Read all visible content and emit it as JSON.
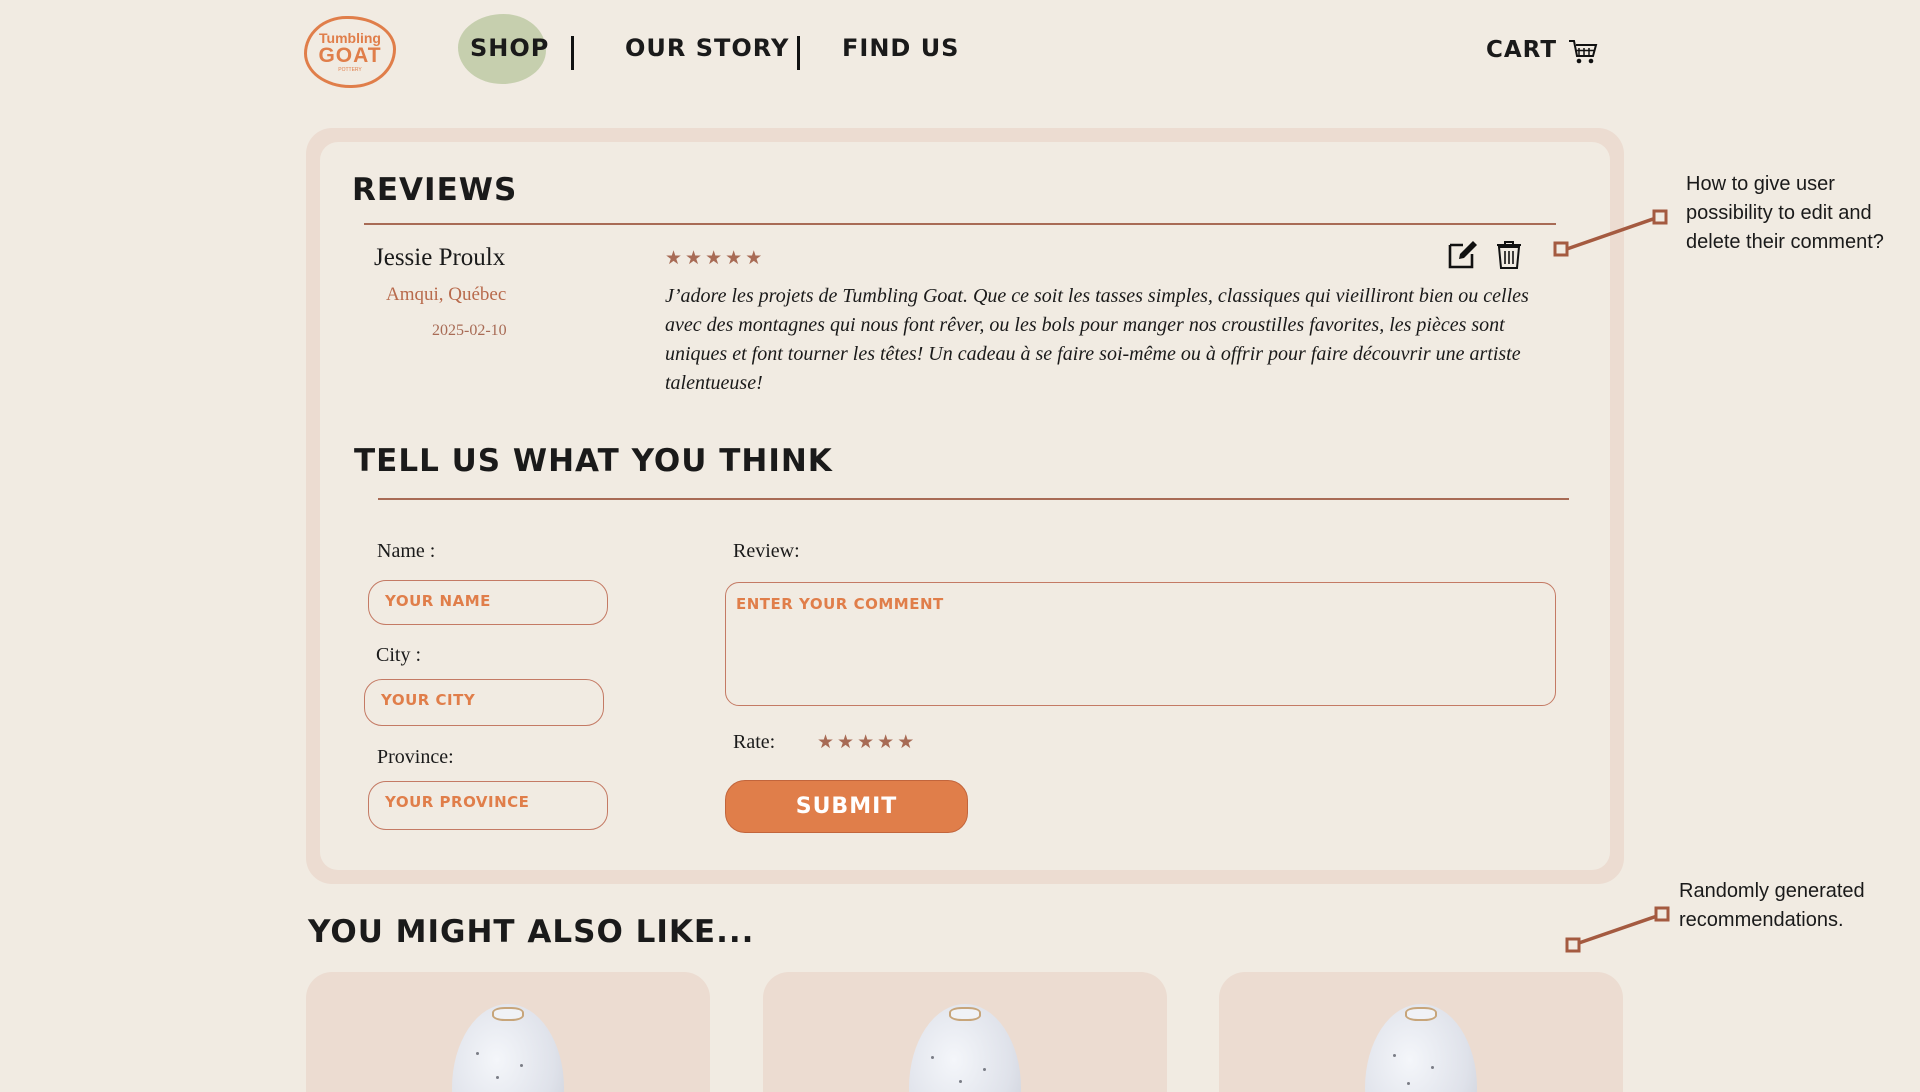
{
  "nav": {
    "logo": {
      "line1": "Tumbling",
      "line2": "GOAT",
      "line3": "POTTERY"
    },
    "items": [
      {
        "label": "Shop"
      },
      {
        "label": "Our Story"
      },
      {
        "label": "Find Us"
      }
    ],
    "cart_label": "CART"
  },
  "reviews": {
    "heading": "Reviews",
    "items": [
      {
        "name": "Jessie Proulx",
        "location": "Amqui, Québec",
        "date": "2025-02-10",
        "rating": 5,
        "text": "J’adore les projets de Tumbling Goat. Que ce soit les tasses simples, classiques qui vieilliront bien ou celles avec des montagnes qui nous font rêver, ou les bols pour manger nos croustilles favorites, les pièces sont uniques et font tourner les têtes! Un cadeau à se faire soi-même ou à offrir pour faire découvrir une artiste talentueuse!"
      }
    ]
  },
  "form": {
    "heading": "Tell us what you think",
    "name_label": "Name :",
    "name_placeholder": "Your name",
    "city_label": "City :",
    "city_placeholder": "Your city",
    "province_label": "Province:",
    "province_placeholder": "Your province",
    "review_label": "Review:",
    "review_placeholder": "Enter your comment",
    "rate_label": "Rate:",
    "rate_stars": 5,
    "submit_label": "Submit"
  },
  "recommendations": {
    "heading": "You might also like...",
    "products": [
      {
        "image": "speckled-vase"
      },
      {
        "image": "speckled-vase"
      },
      {
        "image": "speckled-vase"
      }
    ]
  },
  "annotations": {
    "edit_delete": "How to give user possibility to edit and delete their comment?",
    "recommendations": "Randomly generated recommendations."
  },
  "colors": {
    "background": "#f1ebe2",
    "card": "#ecdcd1",
    "accent": "#e07e4a",
    "shop_highlight": "#c6cfae",
    "rule": "#a86b55",
    "star": "#a86b55"
  },
  "icons": {
    "cart": "cart-icon",
    "edit": "edit-icon",
    "delete": "trash-icon",
    "star": "star-icon"
  }
}
